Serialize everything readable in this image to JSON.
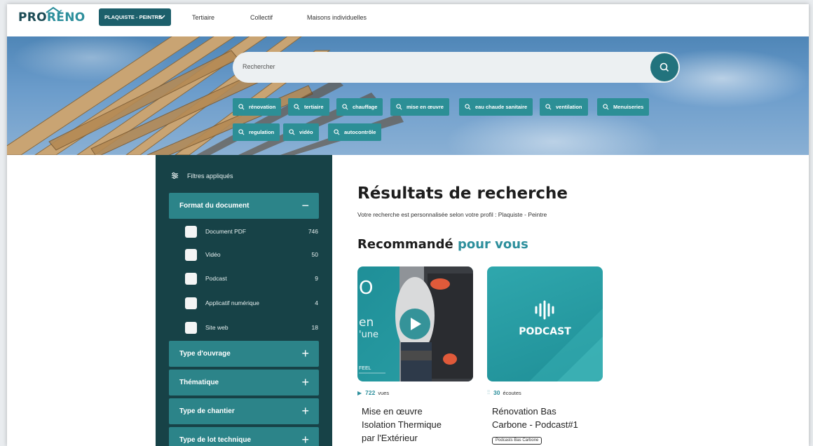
{
  "header": {
    "logo_left": "PRO",
    "logo_right": "RÉNO",
    "profile_dropdown": "PLAQUISTE - PEINTRE",
    "nav": [
      "Tertiaire",
      "Collectif",
      "Maisons individuelles"
    ]
  },
  "search": {
    "placeholder": "Rechercher",
    "chips": [
      "rénovation",
      "tertiaire",
      "chauffage",
      "mise en œuvre",
      "eau chaude sanitaire",
      "ventilation",
      "Menuiseries",
      "regulation",
      "vidéo",
      "autocontrôle"
    ]
  },
  "sidebar": {
    "filters_label": "Filtres appliqués",
    "format": {
      "title": "Format du document",
      "sign": "−",
      "options": [
        {
          "label": "Document PDF",
          "count": "746"
        },
        {
          "label": "Vidéo",
          "count": "50"
        },
        {
          "label": "Podcast",
          "count": "9"
        },
        {
          "label": "Applicatif numérique",
          "count": "4"
        },
        {
          "label": "Site web",
          "count": "18"
        }
      ]
    },
    "sections": [
      {
        "title": "Type d'ouvrage",
        "sign": "+"
      },
      {
        "title": "Thématique",
        "sign": "+"
      },
      {
        "title": "Type de chantier",
        "sign": "+"
      },
      {
        "title": "Type de lot technique",
        "sign": "+"
      }
    ]
  },
  "main": {
    "title": "Résultats de recherche",
    "subtitle": "Votre recherche est personnalisée selon votre profil : Plaquiste - Peintre",
    "reco_title_a": "Recommandé",
    "reco_title_b": "pour vous",
    "cards": [
      {
        "overlay_o": "O",
        "overlay_en": "en",
        "overlay_une": "'une",
        "overlay_brand": "FEEL",
        "count": "722",
        "count_unit": "vues",
        "title_lines": [
          "Mise en œuvre",
          "Isolation Thermique",
          "par l'Extérieur"
        ]
      },
      {
        "overlay_label": "PODCAST",
        "count": "30",
        "count_unit": "écoutes",
        "title_lines": [
          "Rénovation Bas",
          "Carbone - Podcast#1"
        ],
        "tag": "Podcasts Bas Carbone"
      }
    ]
  },
  "colors": {
    "primary_dark": "#174247",
    "primary": "#2c8f96",
    "dropdown": "#1c5f6b",
    "accent_text": "#2d8f9c"
  }
}
